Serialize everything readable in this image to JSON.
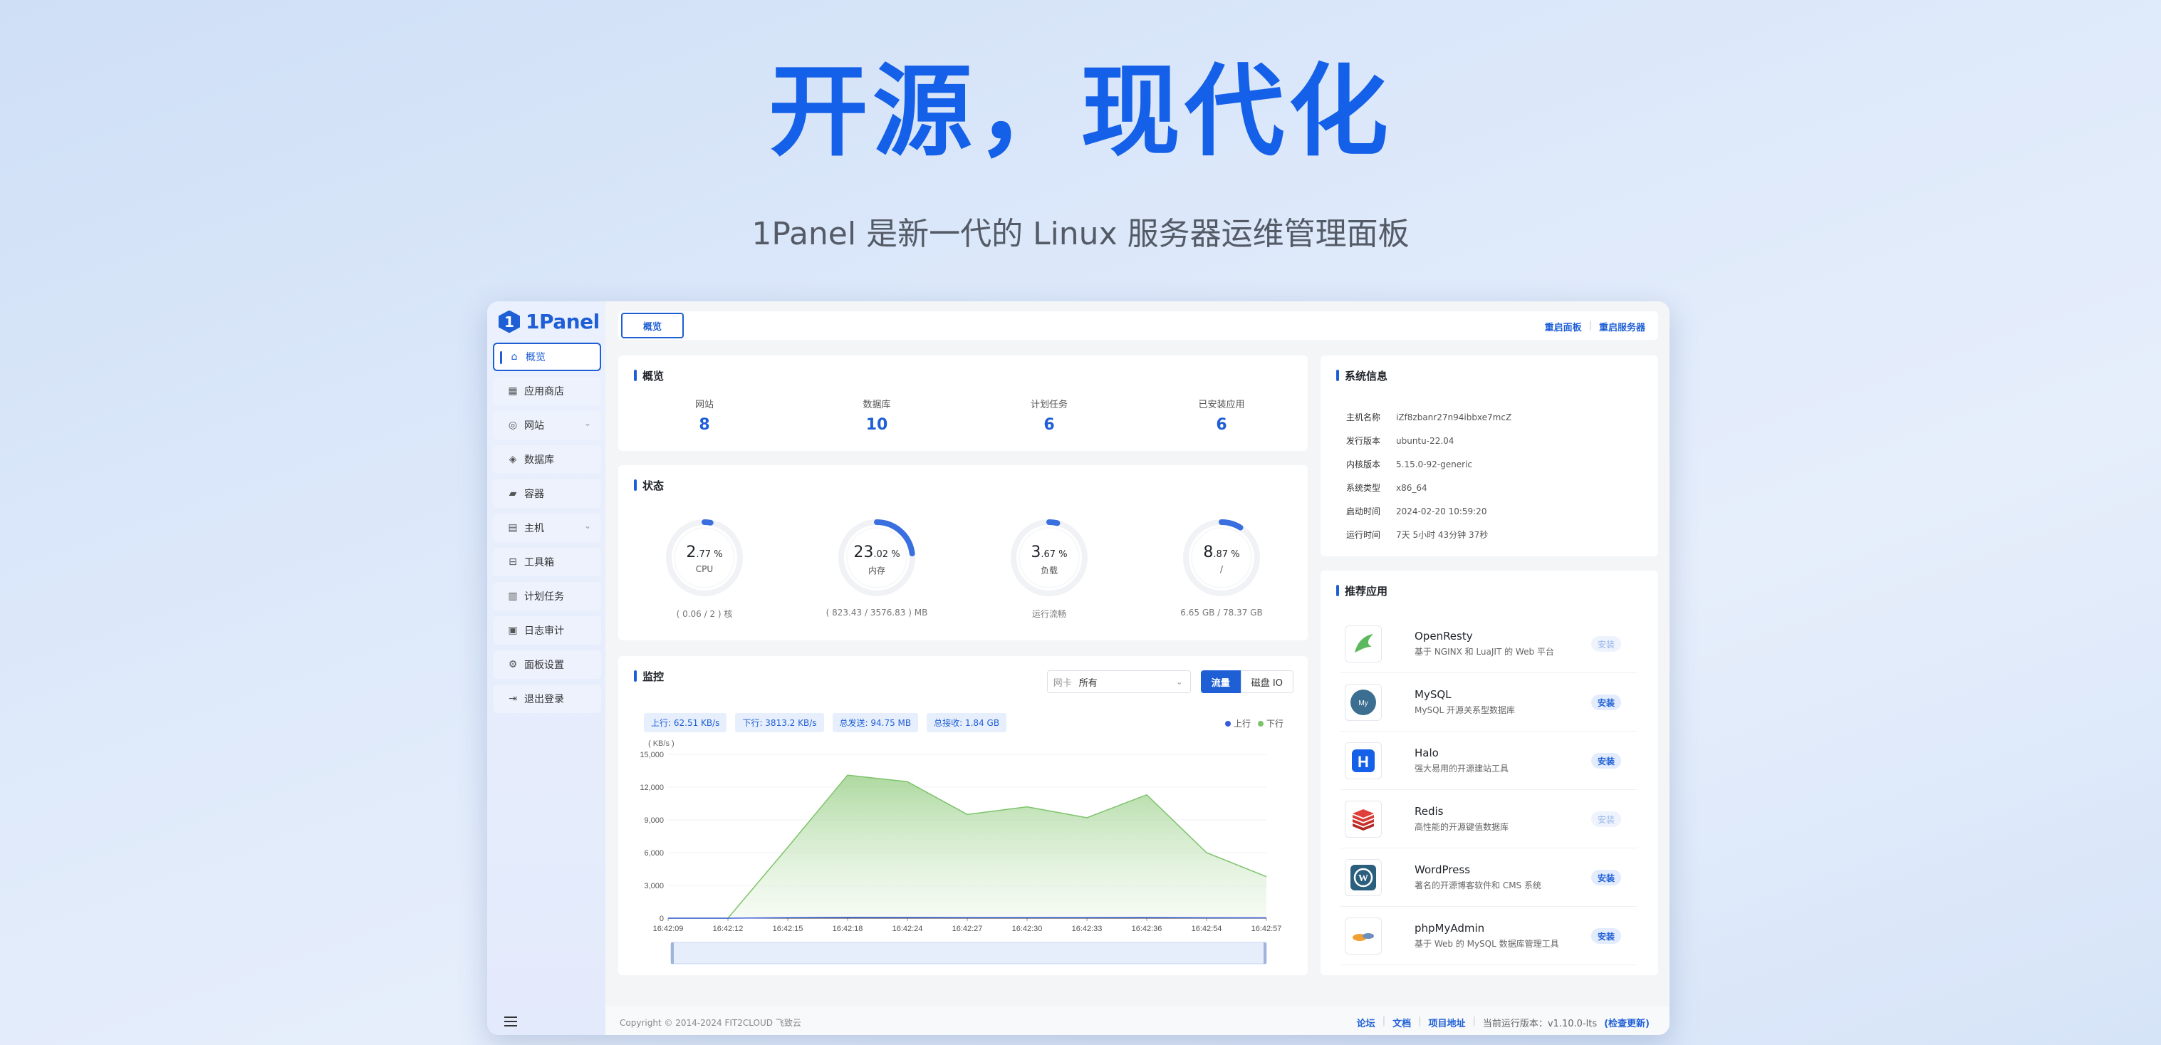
{
  "hero": {
    "title": "开源，现代化",
    "subtitle": "1Panel 是新一代的 Linux 服务器运维管理面板"
  },
  "brand": {
    "logo_text": "1Panel",
    "accent": "#1f5fd6"
  },
  "sidebar": {
    "items": [
      {
        "label": "概览",
        "icon": "home-icon",
        "active": true
      },
      {
        "label": "应用商店",
        "icon": "apps-icon"
      },
      {
        "label": "网站",
        "icon": "globe-icon",
        "expandable": true
      },
      {
        "label": "数据库",
        "icon": "database-icon"
      },
      {
        "label": "容器",
        "icon": "container-icon"
      },
      {
        "label": "主机",
        "icon": "server-icon",
        "expandable": true
      },
      {
        "label": "工具箱",
        "icon": "toolbox-icon"
      },
      {
        "label": "计划任务",
        "icon": "cron-icon"
      },
      {
        "label": "日志审计",
        "icon": "log-icon"
      },
      {
        "label": "面板设置",
        "icon": "gear-icon"
      },
      {
        "label": "退出登录",
        "icon": "logout-icon"
      }
    ]
  },
  "topbar": {
    "tab": "概览",
    "restart_panel": "重启面板",
    "restart_server": "重启服务器"
  },
  "overview": {
    "title": "概览",
    "items": [
      {
        "label": "网站",
        "value": "8"
      },
      {
        "label": "数据库",
        "value": "10"
      },
      {
        "label": "计划任务",
        "value": "6"
      },
      {
        "label": "已安装应用",
        "value": "6"
      }
    ]
  },
  "status": {
    "title": "状态",
    "gauges": [
      {
        "int": "2",
        "dec": ".77 %",
        "label": "CPU",
        "foot": "( 0.06 / 2 ) 核",
        "percent": 2.77
      },
      {
        "int": "23",
        "dec": ".02 %",
        "label": "内存",
        "foot": "( 823.43 / 3576.83 ) MB",
        "percent": 23.02
      },
      {
        "int": "3",
        "dec": ".67 %",
        "label": "负载",
        "foot": "运行流畅",
        "percent": 3.67
      },
      {
        "int": "8",
        "dec": ".87 %",
        "label": "/",
        "foot": "6.65 GB / 78.37 GB",
        "percent": 8.87
      }
    ]
  },
  "monitor": {
    "title": "监控",
    "netcard_prefix": "网卡",
    "netcard_value": "所有",
    "btn_traffic": "流量",
    "btn_disk": "磁盘 IO",
    "pills": [
      "上行: 62.51 KB/s",
      "下行: 3813.2 KB/s",
      "总发送: 94.75 MB",
      "总接收: 1.84 GB"
    ],
    "legend_up": "上行",
    "legend_down": "下行",
    "up_color": "#3a5bd9",
    "down_color": "#7dc36b"
  },
  "chart_data": {
    "type": "area",
    "ylabel": "( KB/s )",
    "ylim": [
      0,
      15000
    ],
    "yticks": [
      "15,000",
      "12,000",
      "9,000",
      "6,000",
      "3,000",
      "0"
    ],
    "x": [
      "16:42:09",
      "16:42:12",
      "16:42:15",
      "16:42:18",
      "16:42:24",
      "16:42:27",
      "16:42:30",
      "16:42:33",
      "16:42:36",
      "16:42:54",
      "16:42:57"
    ],
    "series": [
      {
        "name": "上行",
        "values": [
          0,
          0,
          50,
          80,
          70,
          60,
          60,
          55,
          65,
          40,
          30
        ]
      },
      {
        "name": "下行",
        "values": [
          0,
          0,
          6500,
          13100,
          12500,
          9500,
          10200,
          9200,
          11300,
          6000,
          3800
        ]
      }
    ],
    "grid": true,
    "legend": "top-right"
  },
  "sysinfo": {
    "title": "系统信息",
    "rows": [
      {
        "key": "主机名称",
        "value": "iZf8zbanr27n94ibbxe7mcZ"
      },
      {
        "key": "发行版本",
        "value": "ubuntu-22.04"
      },
      {
        "key": "内核版本",
        "value": "5.15.0-92-generic"
      },
      {
        "key": "系统类型",
        "value": "x86_64"
      },
      {
        "key": "启动时间",
        "value": "2024-02-20 10:59:20"
      },
      {
        "key": "运行时间",
        "value": "7天 5小时 43分钟 37秒"
      }
    ]
  },
  "recommend": {
    "title": "推荐应用",
    "apps": [
      {
        "name": "OpenResty",
        "desc": "基于 NGINX 和 LuaJIT 的 Web 平台",
        "btn": "安装",
        "installed": true,
        "icon": "openresty-icon"
      },
      {
        "name": "MySQL",
        "desc": "MySQL 开源关系型数据库",
        "btn": "安装",
        "installed": false,
        "icon": "mysql-icon"
      },
      {
        "name": "Halo",
        "desc": "强大易用的开源建站工具",
        "btn": "安装",
        "installed": false,
        "icon": "halo-icon"
      },
      {
        "name": "Redis",
        "desc": "高性能的开源键值数据库",
        "btn": "安装",
        "installed": true,
        "icon": "redis-icon"
      },
      {
        "name": "WordPress",
        "desc": "著名的开源博客软件和 CMS 系统",
        "btn": "安装",
        "installed": false,
        "icon": "wordpress-icon"
      },
      {
        "name": "phpMyAdmin",
        "desc": "基于 Web 的 MySQL 数据库管理工具",
        "btn": "安装",
        "installed": false,
        "icon": "phpmyadmin-icon"
      }
    ]
  },
  "footer": {
    "copyright": "Copyright © 2014-2024 FIT2CLOUD 飞致云",
    "forum": "论坛",
    "docs": "文档",
    "project": "项目地址",
    "version_label": "当前运行版本：v1.10.0-lts",
    "check_update": "(检查更新)"
  }
}
